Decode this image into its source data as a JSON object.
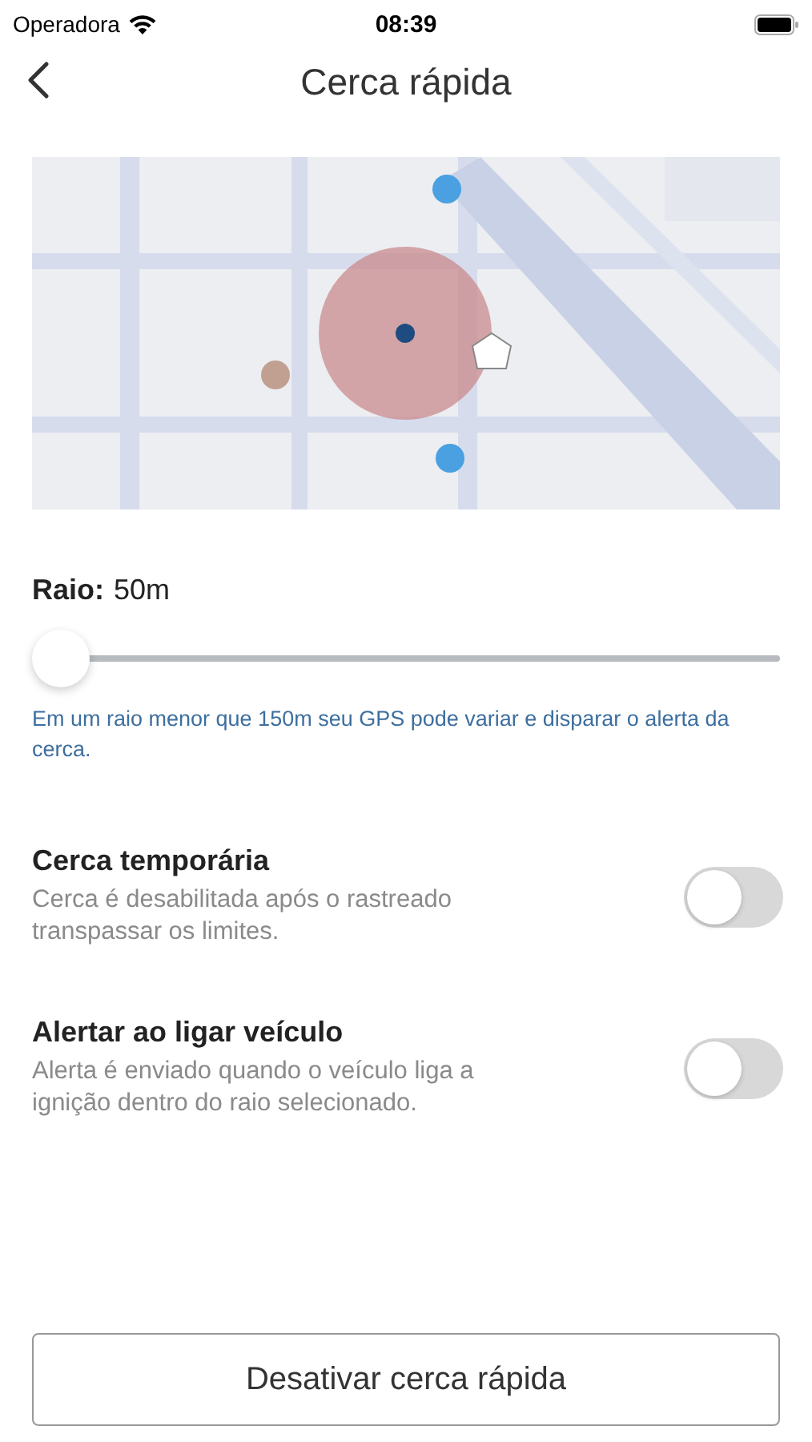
{
  "status_bar": {
    "carrier": "Operadora",
    "time": "08:39"
  },
  "nav": {
    "title": "Cerca rápida"
  },
  "radius": {
    "label": "Raio:",
    "value": "50m",
    "level": 0,
    "hint": "Em um raio menor que 150m seu GPS pode variar e disparar o alerta da cerca."
  },
  "settings": [
    {
      "title": "Cerca temporária",
      "description": "Cerca é desabilitada após o rastreado transpassar os limites.",
      "on": false
    },
    {
      "title": "Alertar ao ligar veículo",
      "description": "Alerta é enviado quando o veículo liga a ignição dentro do raio selecionado.",
      "on": false
    }
  ],
  "button": "Desativar cerca rápida"
}
